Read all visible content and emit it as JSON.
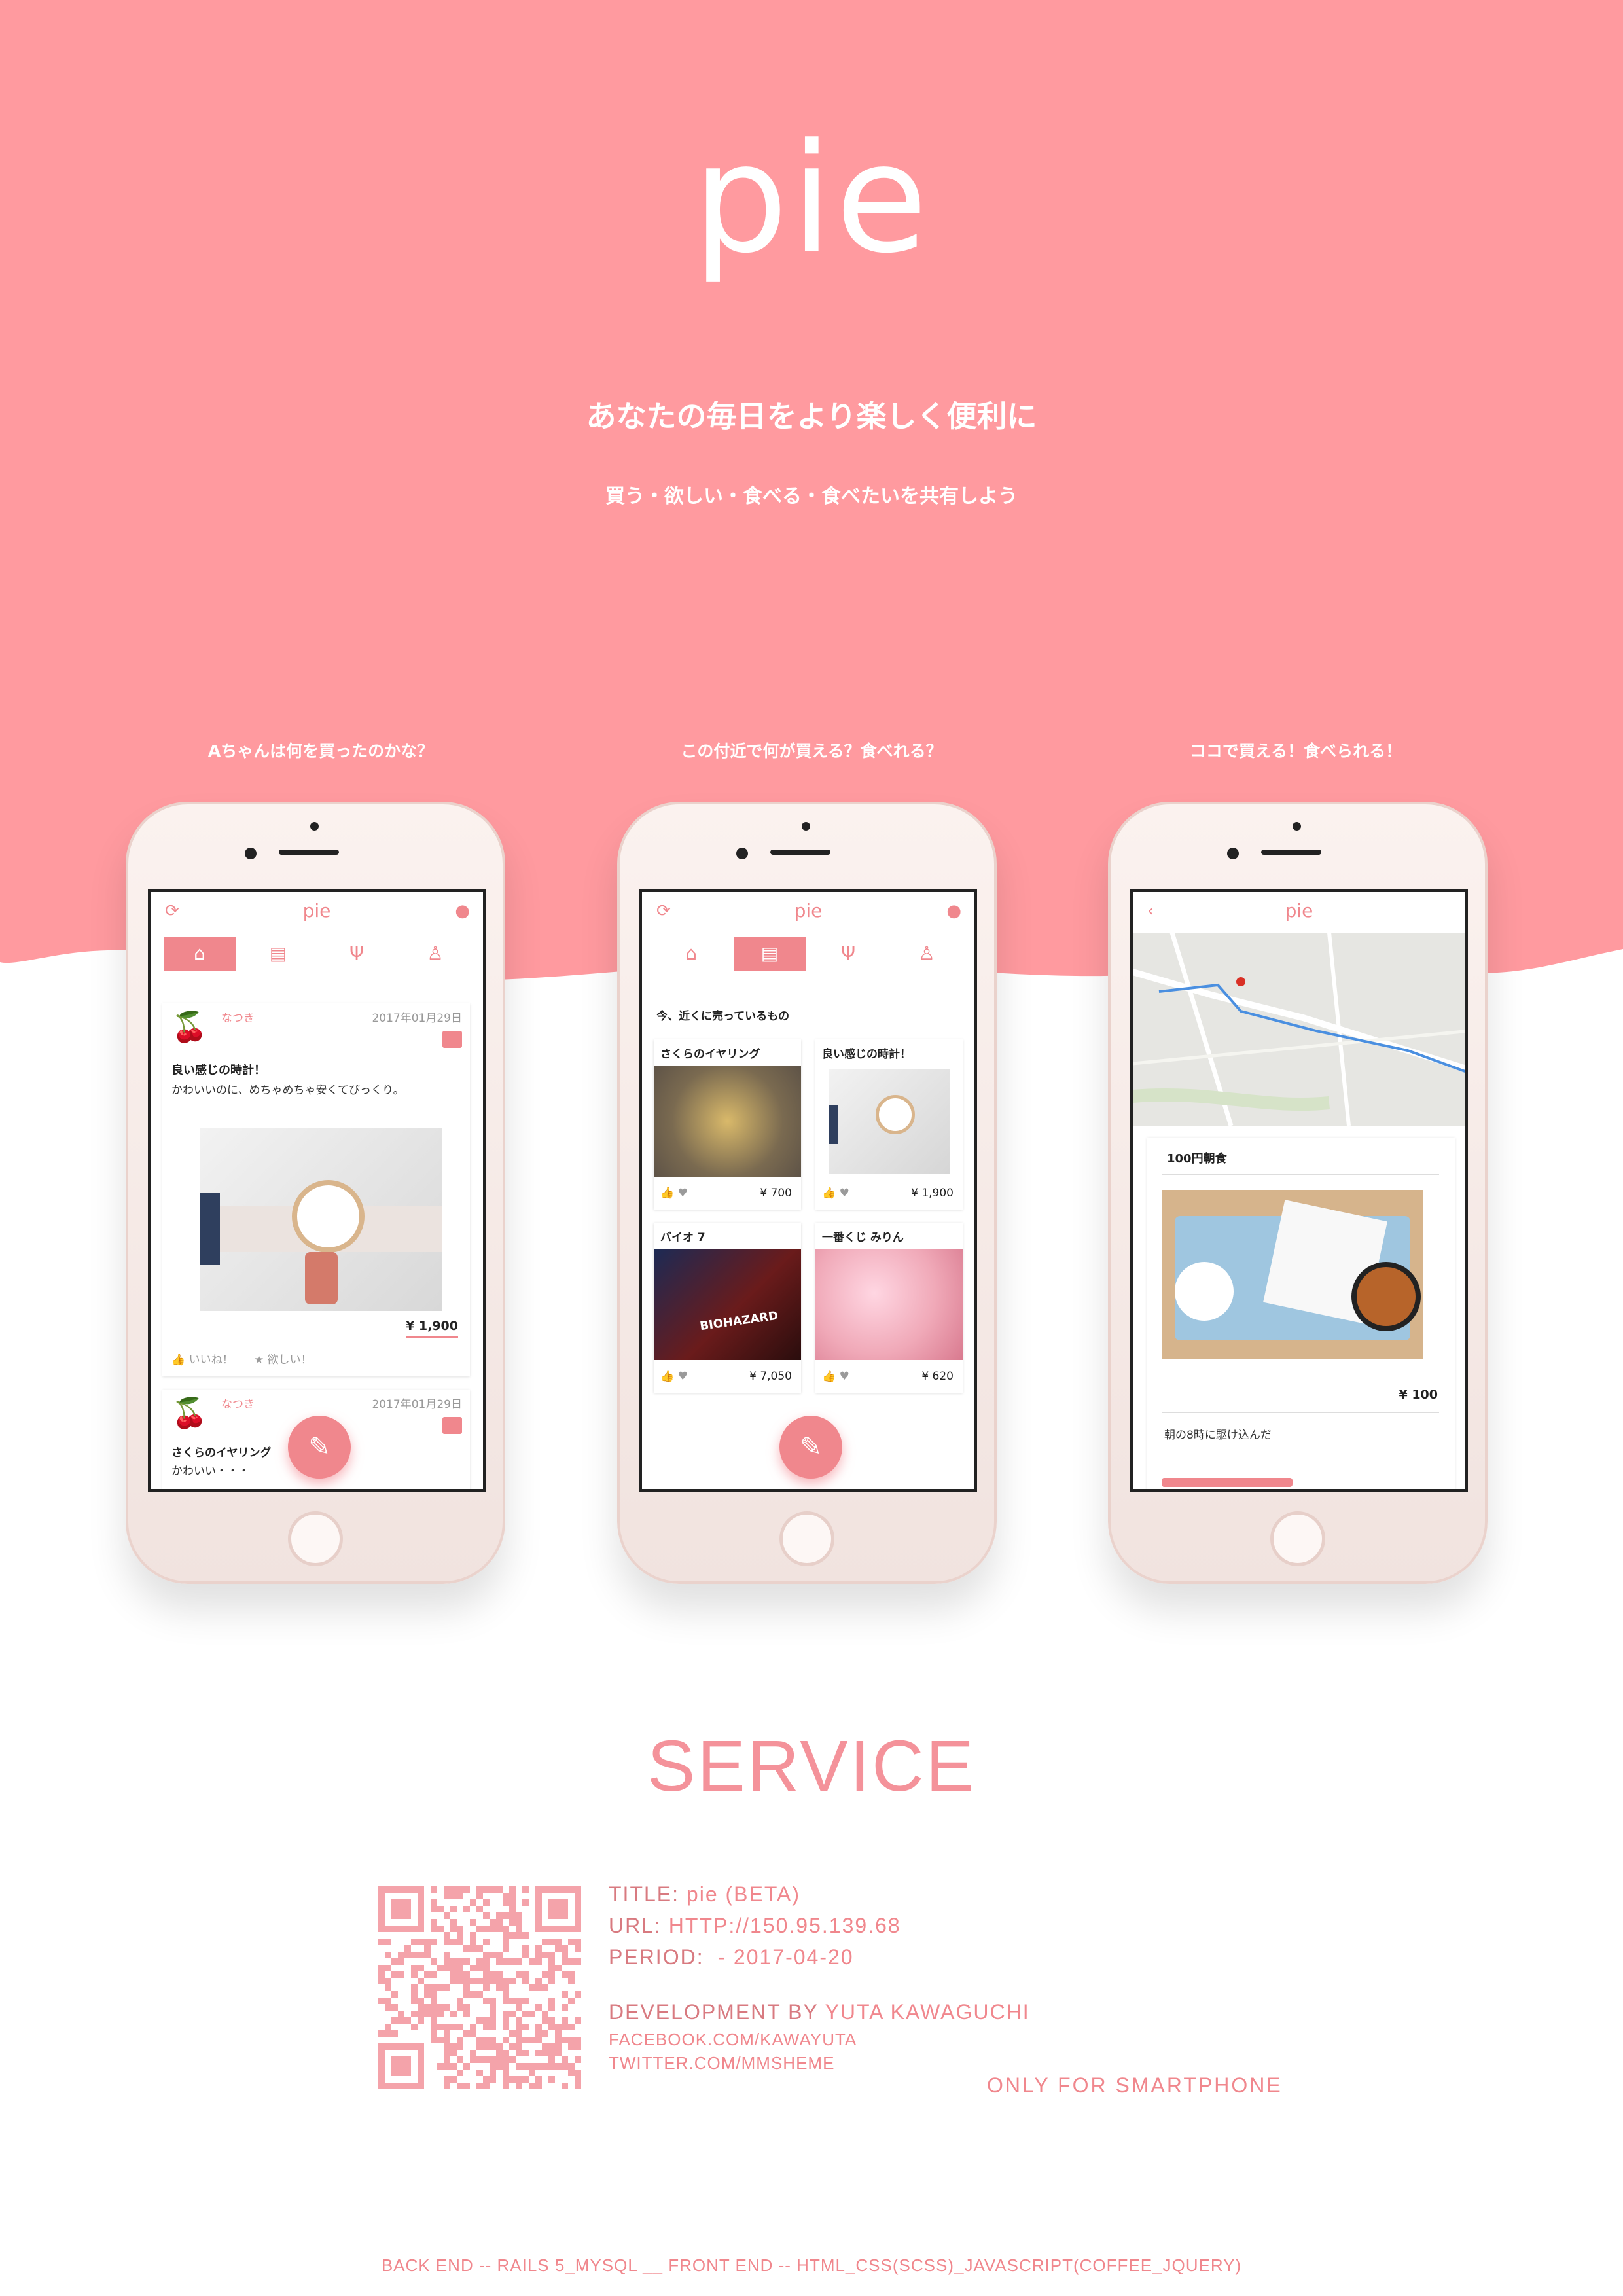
{
  "colors": {
    "brand_pink": "#ff9a9f",
    "accent": "#f0878d",
    "white": "#ffffff"
  },
  "hero": {
    "logo": "pie",
    "headline": "あなたの毎日をより楽しく便利に",
    "subline": "買う・欲しい・食べる・食べたいを共有しよう"
  },
  "captions": [
    "Aちゃんは何を買ったのかな？",
    "この付近で何が買える？食べれる？",
    "ココで買える！食べられる！"
  ],
  "phone1": {
    "app_title": "pie",
    "icons": {
      "left": "refresh-icon",
      "right": "user-icon"
    },
    "tabs": [
      {
        "icon": "home-icon",
        "glyph": "⌂",
        "active": true
      },
      {
        "icon": "bag-icon",
        "glyph": "▤",
        "active": false
      },
      {
        "icon": "fork-knife-icon",
        "glyph": "Ψ",
        "active": false
      },
      {
        "icon": "person-icon",
        "glyph": "♙",
        "active": false
      }
    ],
    "posts": [
      {
        "user": "なつき",
        "date": "2017年01月29日",
        "title": "良い感じの時計！",
        "body": "かわいいのに、めちゃめちゃ安くてびっくり。",
        "price": "¥ 1,900",
        "like_label": "いいね！",
        "want_label": "欲しい！"
      },
      {
        "user": "なつき",
        "date": "2017年01月29日",
        "title": "さくらのイヤリング",
        "body": "かわいい・・・"
      }
    ]
  },
  "phone2": {
    "app_title": "pie",
    "section_title": "今、近くに売っているもの",
    "items": [
      {
        "title": "さくらのイヤリング",
        "price": "¥ 700"
      },
      {
        "title": "良い感じの時計！",
        "price": "¥ 1,900"
      },
      {
        "title": "バイオ 7",
        "price": "¥ 7,050",
        "image_text": "BIOHAZARD"
      },
      {
        "title": "一番くじ みりん",
        "price": "¥ 620"
      }
    ]
  },
  "phone3": {
    "app_title": "pie",
    "card_title": "100円朝食",
    "price": "¥ 100",
    "comment": "朝の8時に駆け込んだ"
  },
  "service": {
    "heading": "SERVICE",
    "title_label": "TITLE:",
    "title_value": "pie (BETA)",
    "url_label": "URL:",
    "url_value": "HTTP://150.95.139.68",
    "period_label": "PERIOD:",
    "period_value": "  - 2017-04-20",
    "dev_label": "DEVELOPMENT BY",
    "dev_value": "YUTA KAWAGUCHI",
    "facebook": "FACEBOOK.COM/KAWAYUTA",
    "twitter": "TWITTER.COM/MMSHEME",
    "only": "ONLY FOR SMARTPHONE",
    "footer": "BACK END -- RAILS 5_MYSQL __ FRONT END -- HTML_CSS(SCSS)_JAVASCRIPT(COFFEE_JQUERY)"
  }
}
